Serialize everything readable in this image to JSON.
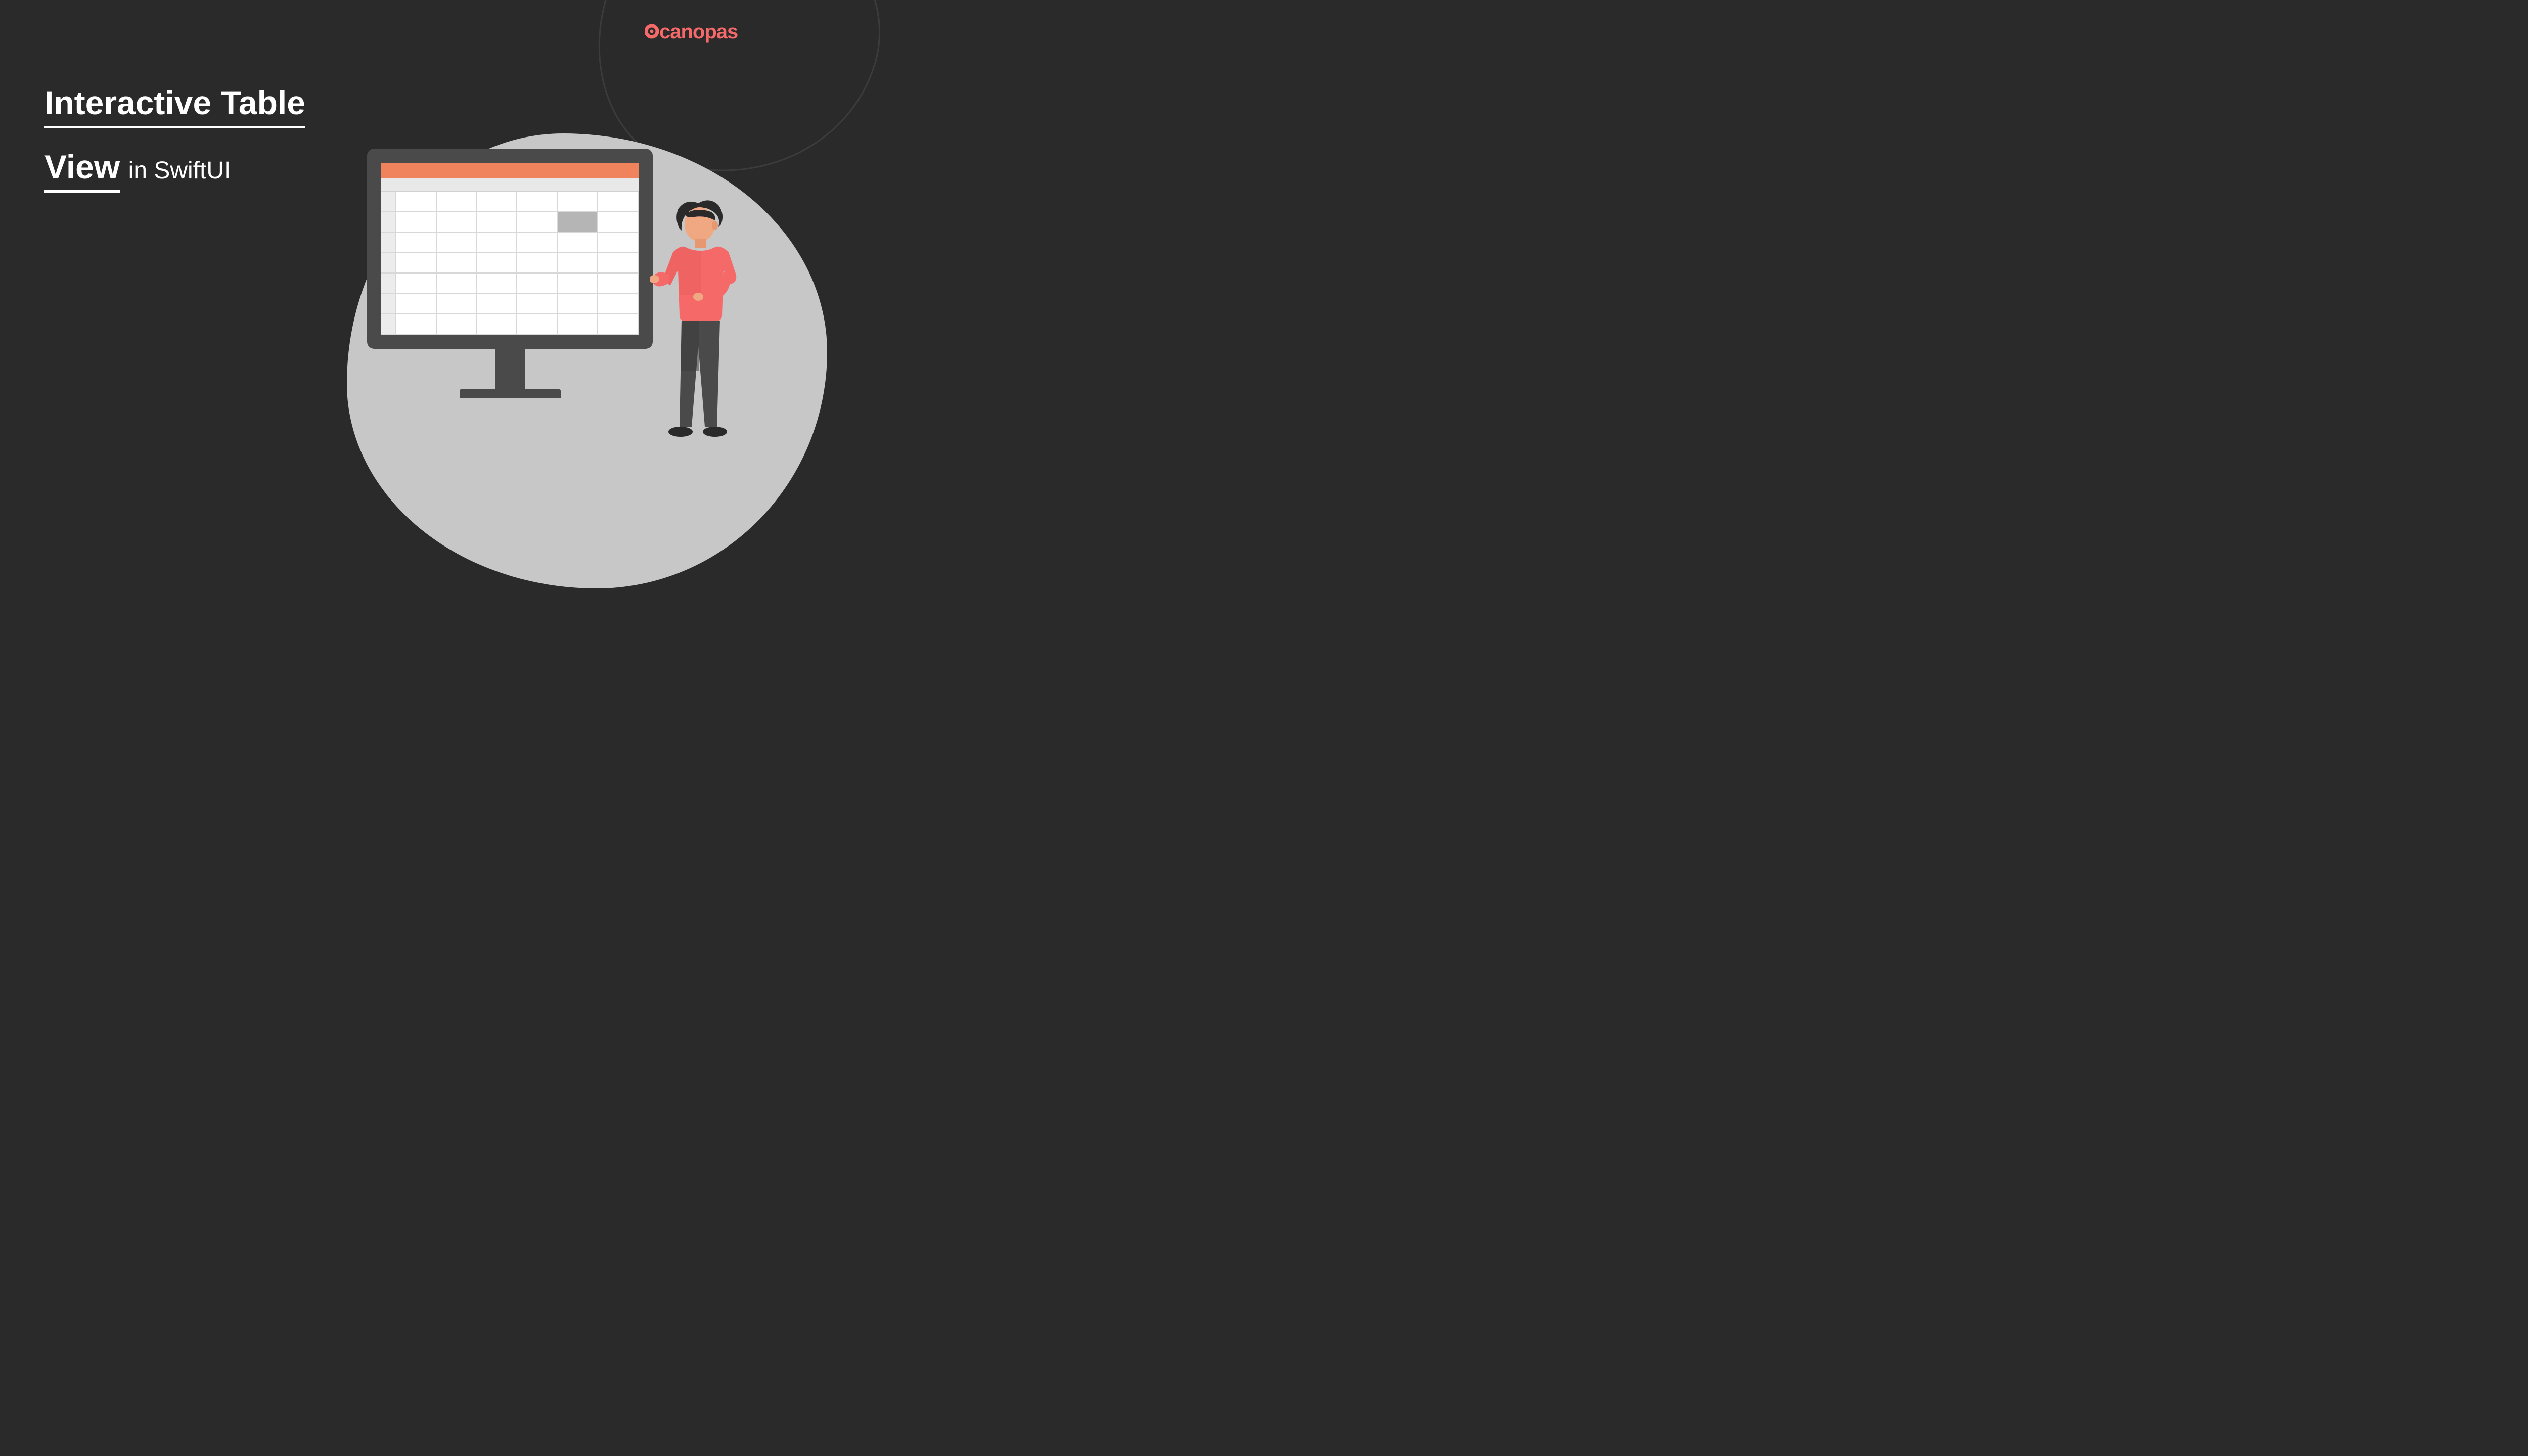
{
  "brand": {
    "name": "canopas",
    "color": "#f56969"
  },
  "title": {
    "line1": "Interactive Table",
    "line2_underlined": "View",
    "line2_plain": "in SwiftUI"
  },
  "illustration": {
    "monitor": {
      "frame_color": "#4a4a4a",
      "title_bar_color": "#f0835b",
      "spreadsheet": {
        "rows": 7,
        "columns": 6,
        "selected_cell": {
          "row": 1,
          "col": 4
        }
      }
    },
    "person": {
      "shirt_color": "#f56969",
      "pants_color": "#4a4a4a",
      "hair_color": "#2a2a2a"
    }
  },
  "colors": {
    "background": "#2a2a2a",
    "blob": "#c7c7c7",
    "text": "#ffffff"
  }
}
